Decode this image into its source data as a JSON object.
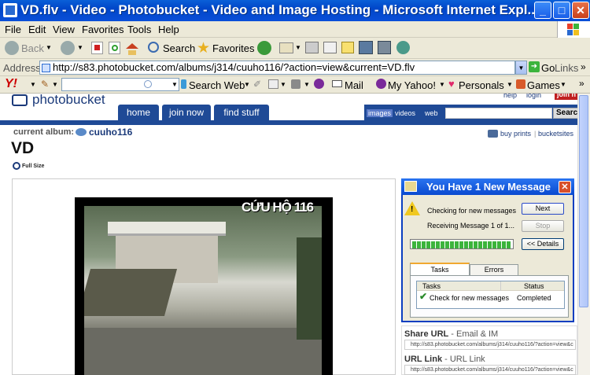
{
  "window": {
    "title": "VD.flv - Video - Photobucket - Video and Image Hosting - Microsoft Internet Expl..."
  },
  "menu": [
    "File",
    "Edit",
    "View",
    "Favorites",
    "Tools",
    "Help"
  ],
  "toolbar": {
    "back": "Back",
    "search": "Search",
    "favorites": "Favorites"
  },
  "address": {
    "label": "Address",
    "url": "http://s83.photobucket.com/albums/j314/cuuho116/?action=view&current=VD.flv",
    "go": "Go",
    "links": "Links"
  },
  "yahoo": {
    "search_web": "Search Web",
    "mail": "Mail",
    "my_yahoo": "My Yahoo!",
    "personals": "Personals",
    "games": "Games"
  },
  "pb": {
    "logo": "photobucket",
    "tabs": [
      "home",
      "join now",
      "find stuff"
    ],
    "help": "help",
    "login": "login",
    "join": "join n",
    "search_tabs": [
      "images",
      "videos",
      "web"
    ],
    "search_btn": "Search",
    "album_label": "current album:",
    "album_name": "cuuho116",
    "title": "VD",
    "fullsize": "Full Size",
    "buy_prints": "buy prints",
    "bucketsites": "bucketsites",
    "video_caption": "CỨU HỘ 116"
  },
  "popup": {
    "title": "You Have 1 New Message",
    "checking": "Checking for new messages",
    "receiving": "Receiving Message 1 of 1...",
    "next": "Next",
    "stop": "Stop",
    "details": "<< Details",
    "tab_tasks": "Tasks",
    "tab_errors": "Errors",
    "col_tasks": "Tasks",
    "col_status": "Status",
    "row_task": "Check for new messages",
    "row_status": "Completed"
  },
  "share": {
    "share_label": "Share URL",
    "share_sub": " - Email & IM",
    "share_url": "http://s83.photobucket.com/albums/j314/cuuho116/?action=view&c",
    "url_label": "URL Link",
    "url_sub": " - URL Link",
    "url_url": "http://s83.photobucket.com/albums/j314/cuuho116/?action=view&c"
  }
}
